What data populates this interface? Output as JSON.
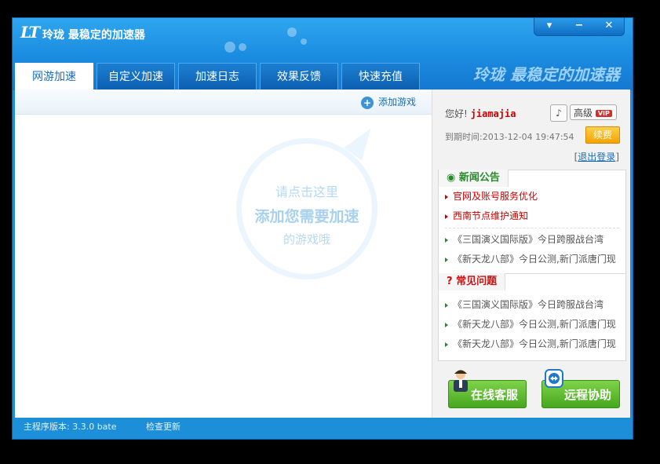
{
  "window": {
    "logo": "LT",
    "title": "玲珑 最稳定的加速器",
    "slogan": "玲珑 最稳定的加速器"
  },
  "controls": {
    "menu": "▾",
    "minimize": "−",
    "close": "✕"
  },
  "tabs": [
    {
      "label": "网游加速",
      "active": true
    },
    {
      "label": "自定义加速"
    },
    {
      "label": "加速日志"
    },
    {
      "label": "效果反馈"
    },
    {
      "label": "快速充值"
    }
  ],
  "main": {
    "add_game": "添加游戏",
    "hint_line1": "请点击这里",
    "hint_line2": "添加您需要加速",
    "hint_line3": "的游戏哦"
  },
  "account": {
    "greeting": "您好!",
    "username": "jiamajia",
    "advanced_label": "高级",
    "vip_badge": "VIP",
    "expire": "到期时间:2013-12-04 19:47:54",
    "renew_label": "续费",
    "logout_open": "[",
    "logout": "退出登录",
    "logout_close": "]"
  },
  "news": {
    "title": "新闻公告",
    "items": [
      "官网及账号服务优化",
      "西南节点维护通知",
      "《三国演义国际版》今日跨服战台湾",
      "《新天龙八部》今日公测,新门派唐门现"
    ]
  },
  "faq": {
    "title": "常见问题",
    "items": [
      "《三国演义国际版》今日跨服战台湾",
      "《新天龙八部》今日公测,新门派唐门现",
      "《新天龙八部》今日公测,新门派唐门现"
    ]
  },
  "buttons": {
    "customer_service": "在线客服",
    "remote_help": "远程协助"
  },
  "statusbar": {
    "version": "主程序版本: 3.3.0 bate",
    "check_update": "检查更新"
  },
  "colors": {
    "brand_blue": "#1d8fd8",
    "accent_green": "#47a71f",
    "accent_red": "#cc0000",
    "renew_orange": "#f3a200"
  }
}
